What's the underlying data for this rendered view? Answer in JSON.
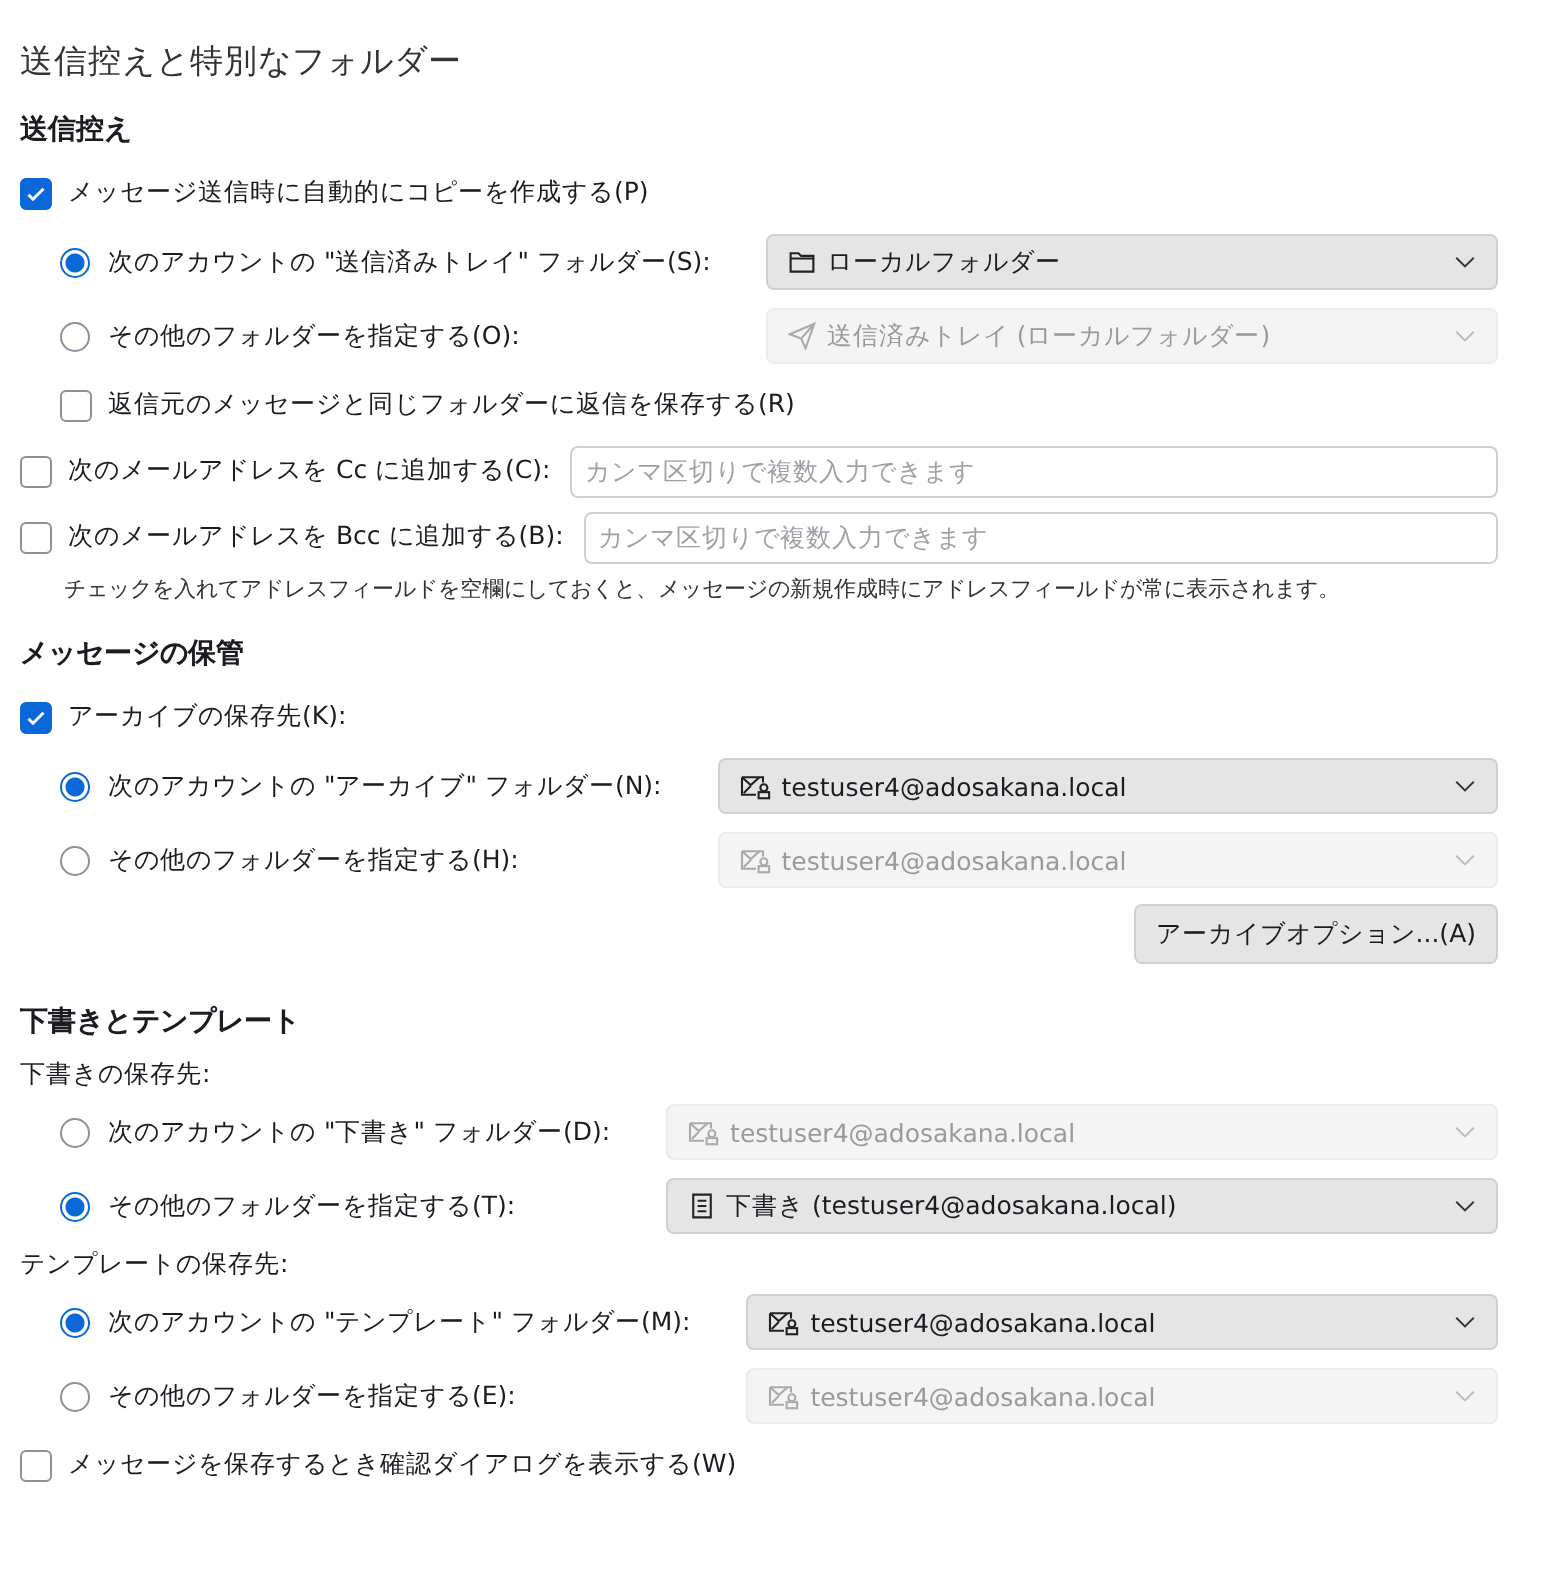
{
  "page_title": "送信控えと特別なフォルダー",
  "sections": [
    {
      "heading": "送信控え",
      "items": [
        {
          "kind": "checkbox",
          "label": "メッセージ送信時に自動的にコピーを作成する(P)",
          "checked": true,
          "children": [
            {
              "kind": "radio_group",
              "options": [
                {
                  "label": "次のアカウントの \"送信済みトレイ\" フォルダー(S):",
                  "selected": true,
                  "select": {
                    "kind": "folder",
                    "text": "ローカルフォルダー",
                    "disabled": false
                  }
                },
                {
                  "label": "その他のフォルダーを指定する(O):",
                  "selected": false,
                  "select": {
                    "kind": "sent",
                    "text": "送信済みトレイ (ローカルフォルダー)",
                    "disabled": true
                  }
                }
              ]
            },
            {
              "kind": "checkbox",
              "label": "返信元のメッセージと同じフォルダーに返信を保存する(R)",
              "checked": false
            }
          ]
        },
        {
          "kind": "address",
          "label": "次のメールアドレスを Cc に追加する(C):",
          "checked": false,
          "placeholder": "カンマ区切りで複数入力できます"
        },
        {
          "kind": "address",
          "label": "次のメールアドレスを Bcc に追加する(B):",
          "checked": false,
          "placeholder": "カンマ区切りで複数入力できます"
        },
        {
          "kind": "note",
          "text": "チェックを入れてアドレスフィールドを空欄にしておくと、メッセージの新規作成時にアドレスフィールドが常に表示されます。"
        }
      ]
    },
    {
      "heading": "メッセージの保管",
      "items": [
        {
          "kind": "checkbox",
          "label": "アーカイブの保存先(K):",
          "checked": true,
          "children": [
            {
              "kind": "radio_group",
              "options": [
                {
                  "label": "次のアカウントの \"アーカイブ\" フォルダー(N):",
                  "selected": true,
                  "select": {
                    "kind": "account",
                    "text": "testuser4@adosakana.local",
                    "disabled": false
                  }
                },
                {
                  "label": "その他のフォルダーを指定する(H):",
                  "selected": false,
                  "select": {
                    "kind": "account",
                    "text": "testuser4@adosakana.local",
                    "disabled": true
                  }
                }
              ]
            }
          ]
        },
        {
          "kind": "button",
          "label": "アーカイブオプション...(A)"
        }
      ]
    },
    {
      "heading": "下書きとテンプレート",
      "items": [
        {
          "kind": "group_label",
          "label": "下書きの保存先:",
          "children": [
            {
              "kind": "radio_group",
              "options": [
                {
                  "label": "次のアカウントの \"下書き\" フォルダー(D):",
                  "selected": false,
                  "select": {
                    "kind": "account",
                    "text": "testuser4@adosakana.local",
                    "disabled": true
                  }
                },
                {
                  "label": "その他のフォルダーを指定する(T):",
                  "selected": true,
                  "select": {
                    "kind": "drafts",
                    "text": "下書き (testuser4@adosakana.local)",
                    "disabled": false
                  }
                }
              ]
            }
          ]
        },
        {
          "kind": "group_label",
          "label": "テンプレートの保存先:",
          "children": [
            {
              "kind": "radio_group",
              "options": [
                {
                  "label": "次のアカウントの \"テンプレート\" フォルダー(M):",
                  "selected": true,
                  "select": {
                    "kind": "account",
                    "text": "testuser4@adosakana.local",
                    "disabled": false
                  }
                },
                {
                  "label": "その他のフォルダーを指定する(E):",
                  "selected": false,
                  "select": {
                    "kind": "account",
                    "text": "testuser4@adosakana.local",
                    "disabled": true
                  }
                }
              ]
            }
          ]
        },
        {
          "kind": "checkbox",
          "label": "メッセージを保存するとき確認ダイアログを表示する(W)",
          "checked": false
        }
      ]
    }
  ]
}
